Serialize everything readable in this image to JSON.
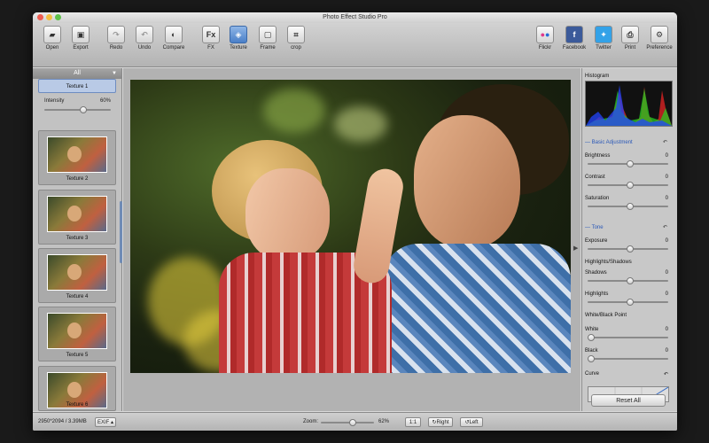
{
  "window": {
    "title": "Photo Effect Studio Pro"
  },
  "toolbar": {
    "open": "Open",
    "export": "Export",
    "redo": "Redo",
    "undo": "Undo",
    "compare": "Compare",
    "fx": "FX",
    "texture": "Texture",
    "frame": "Frame",
    "crop": "crop",
    "flickr": "Flickr",
    "facebook": "Facebook",
    "twitter": "Twitter",
    "print": "Print",
    "preference": "Preference",
    "fx_glyph": "Fx",
    "facebook_glyph": "f"
  },
  "left_panel": {
    "filter": "All",
    "intensity_label": "Intensity",
    "intensity_value": "60%",
    "intensity_level": 0.6,
    "textures": [
      "Texture 1",
      "Texture 2",
      "Texture 3",
      "Texture 4",
      "Texture 5",
      "Texture 6"
    ]
  },
  "right_panel": {
    "histogram_label": "Histogram",
    "basic_adjustment": "Basic Adjustment",
    "brightness": {
      "label": "Brightness",
      "value": "0"
    },
    "contrast": {
      "label": "Contrast",
      "value": "0"
    },
    "saturation": {
      "label": "Saturation",
      "value": "0"
    },
    "tone": "Tone",
    "exposure": {
      "label": "Exposure",
      "value": "0"
    },
    "highlights_shadows": "Highlights/Shadows",
    "shadows": {
      "label": "Shadows",
      "value": "0"
    },
    "highlights": {
      "label": "Highlights",
      "value": "0"
    },
    "white_black_point": "White/Black Point",
    "white": {
      "label": "White",
      "value": "0"
    },
    "black": {
      "label": "Black",
      "value": "0"
    },
    "curve": "Curve",
    "reset_all": "Reset All"
  },
  "status": {
    "dimensions": "2950*2094 / 3.39MB",
    "exif": "EXIF",
    "zoom_label": "Zoom:",
    "zoom_value": "62%",
    "zoom_level": 0.62,
    "one_to_one": "1:1",
    "rotate_right": "Right",
    "rotate_left": "Left"
  },
  "colors": {
    "accent": "#4a7fc8",
    "section": "#2a58b8"
  }
}
